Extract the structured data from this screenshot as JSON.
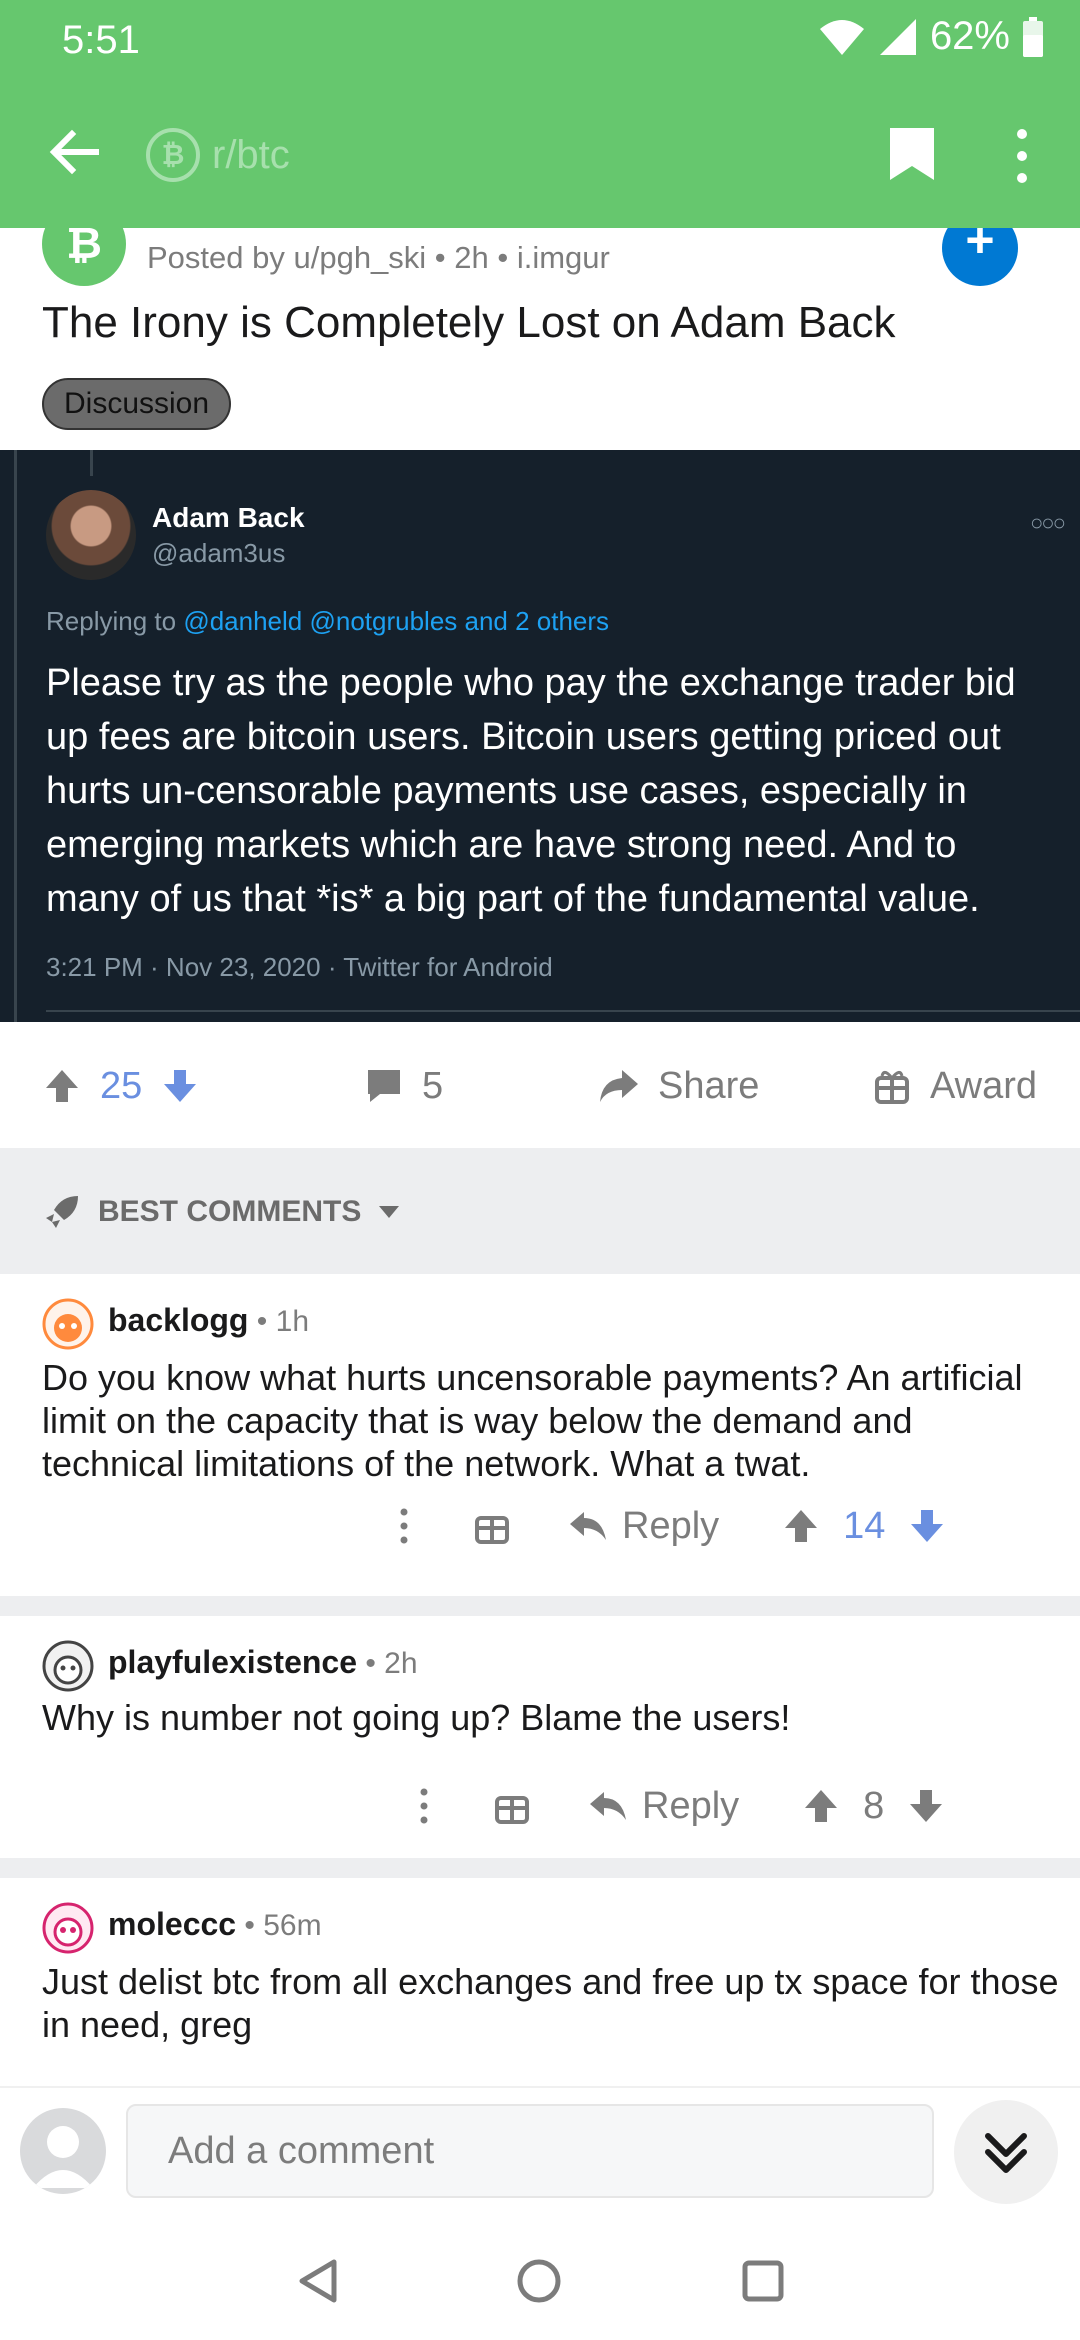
{
  "status_bar": {
    "time": "5:51",
    "battery": "62%"
  },
  "app_bar": {
    "subreddit": "r/btc"
  },
  "post": {
    "posted_by": "Posted by u/pgh_ski • 2h • i.imgur",
    "title": "The Irony is Completely Lost on Adam Back",
    "flair": "Discussion",
    "subreddit_icon_glyph": "₿"
  },
  "tweet": {
    "name": "Adam Back",
    "handle": "@adam3us",
    "replying_prefix": "Replying to ",
    "replying_to": "@danheld @notgrubles and 2 others",
    "text": "Please try as the people who pay the exchange trader bid up fees are bitcoin users. Bitcoin users getting priced out hurts un-censorable payments use cases, especially in emerging markets which are have strong need. And to many of us that *is* a big part of the fundamental value.",
    "meta": "3:21 PM · Nov 23, 2020 · Twitter for Android"
  },
  "actions": {
    "votes": "25",
    "comments": "5",
    "share_label": "Share",
    "award_label": "Award"
  },
  "sort": {
    "label": "BEST COMMENTS"
  },
  "comments": [
    {
      "user": "backlogg",
      "time": " • 1h",
      "body": "Do you know what hurts uncensorable payments? An artificial limit on the capacity that is way below the demand and technical limitations of the network. What a twat.",
      "reply_label": "Reply",
      "votes": "14"
    },
    {
      "user": "playfulexistence",
      "time": " • 2h",
      "body": "Why is number not going up? Blame the users!",
      "reply_label": "Reply",
      "votes": "8"
    },
    {
      "user": "moleccc",
      "time": " • 56m",
      "body": "Just delist btc from all exchanges and free up tx space for those in need, greg"
    }
  ],
  "composer": {
    "placeholder": "Add a comment"
  },
  "colors": {
    "app_bar": "#66c76e",
    "upvote_active": "#6a8fe0",
    "join_button": "#0079d3"
  }
}
